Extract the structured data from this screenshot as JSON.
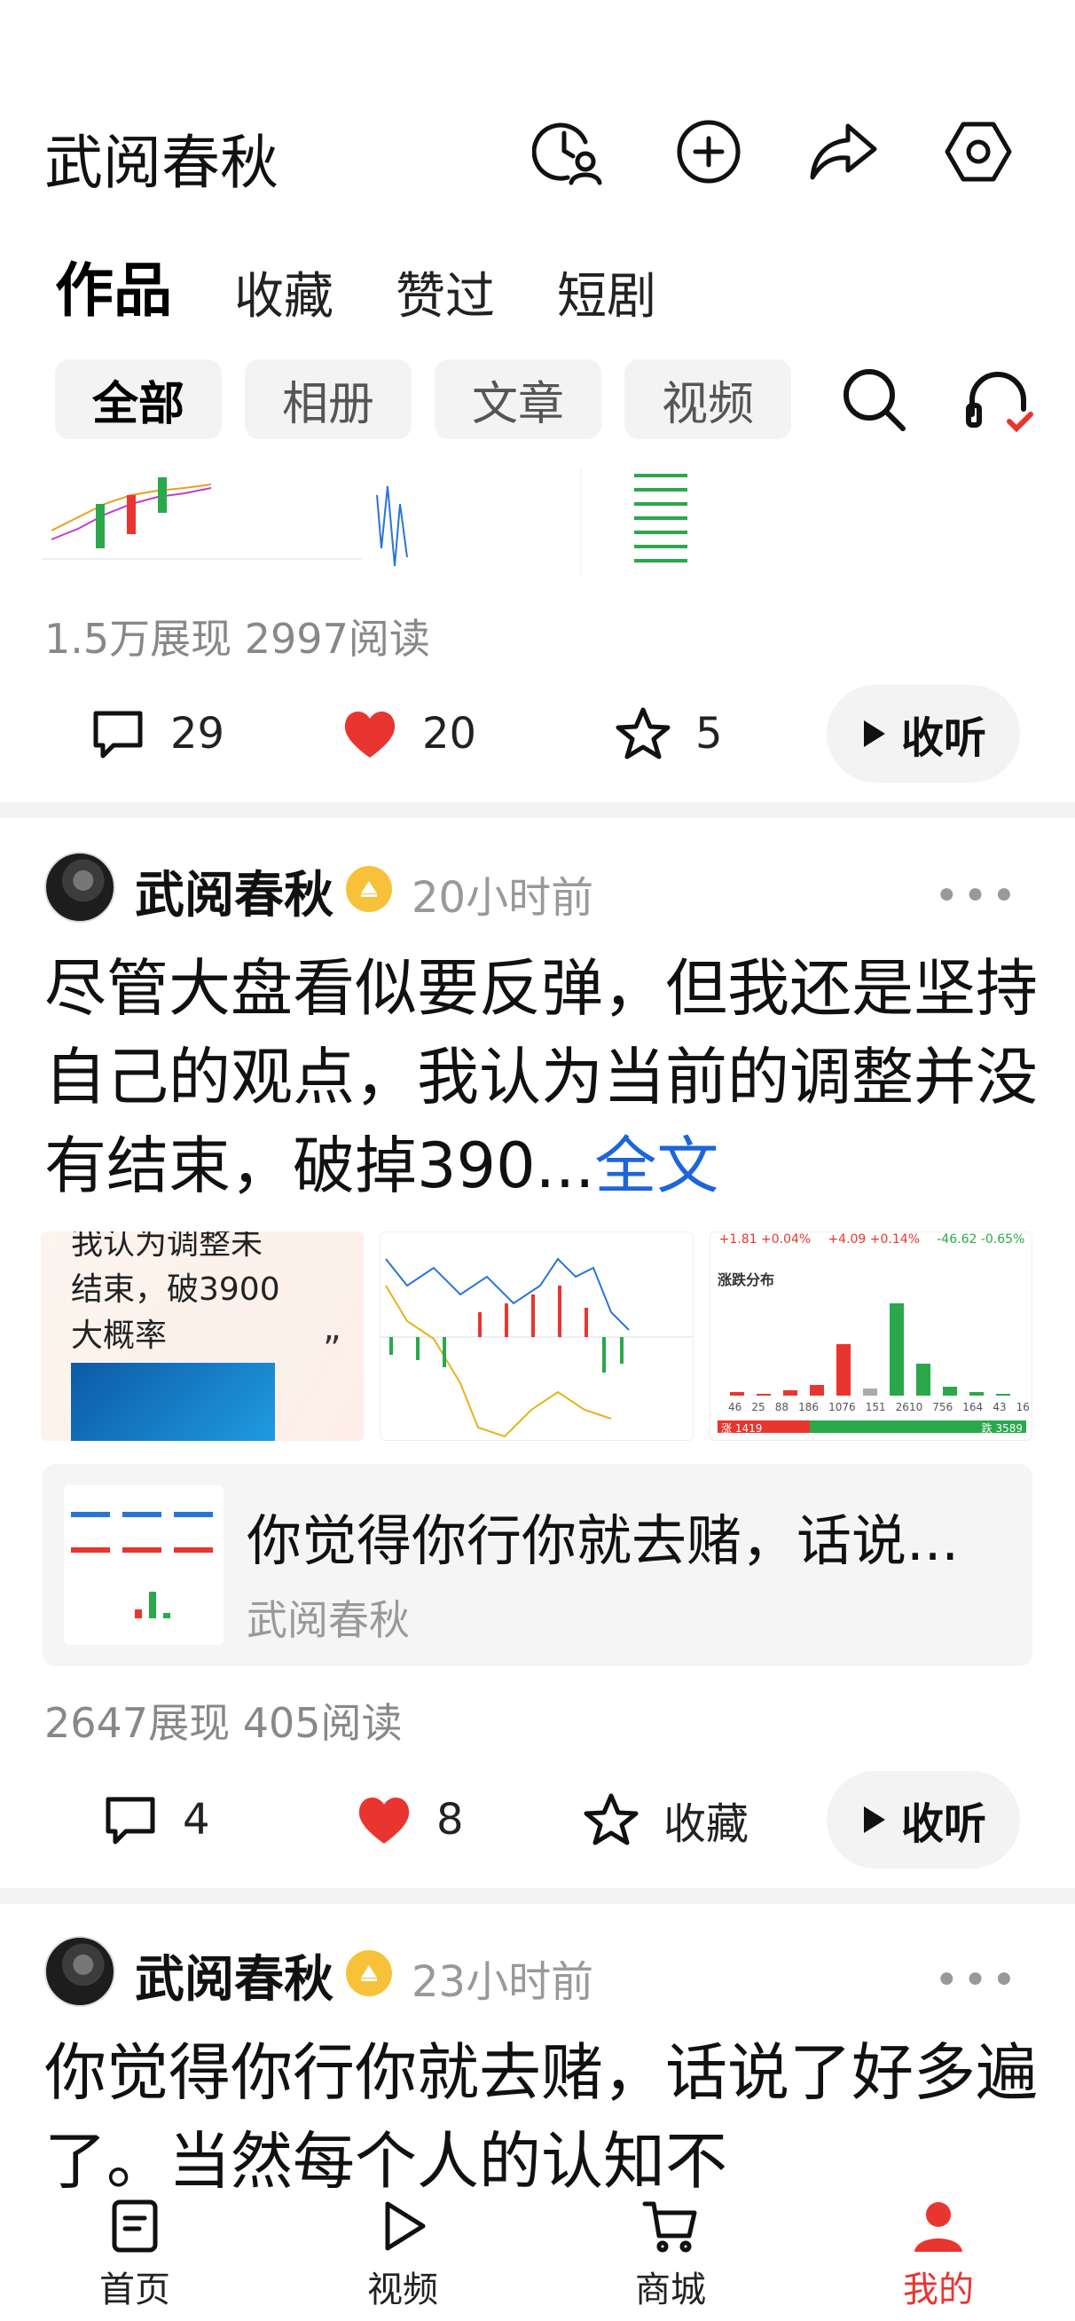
{
  "header": {
    "title": "武阅春秋",
    "icons": [
      "history-user-icon",
      "add-icon",
      "share-icon",
      "settings-icon"
    ]
  },
  "tabs": [
    {
      "label": "作品",
      "active": true
    },
    {
      "label": "收藏",
      "active": false
    },
    {
      "label": "赞过",
      "active": false
    },
    {
      "label": "短剧",
      "active": false
    }
  ],
  "chips": [
    {
      "label": "全部",
      "active": true
    },
    {
      "label": "相册",
      "active": false
    },
    {
      "label": "文章",
      "active": false
    },
    {
      "label": "视频",
      "active": false
    }
  ],
  "post1": {
    "stats": "1.5万展现  2997阅读",
    "comments": "29",
    "likes": "20",
    "favorites": "5",
    "listen": "收听"
  },
  "post2": {
    "author": "武阅春秋",
    "time": "20小时前",
    "text": "尽管大盘看似要反弹，但我还是坚持自己的观点，我认为当前的调整并没有结束，破掉390...",
    "full_link": "全文",
    "image_text": {
      "quote_lines": [
        "我认为调整未",
        "结束，破3900",
        "大概率"
      ],
      "chart_bar_labels": [
        "46",
        "25",
        "88",
        "186",
        "1076",
        "151",
        "2610",
        "756",
        "164",
        "43",
        "16"
      ],
      "chart_title": "涨跌分布",
      "chart_top": [
        "+1.81 +0.04%",
        "+4.09 +0.14%",
        "-46.62 -0.65%"
      ],
      "chart_bottom_left": "涨 1419",
      "chart_bottom_right": "跌 3589"
    },
    "share": {
      "title": "你觉得你行你就去赌，话说...",
      "author": "武阅春秋"
    },
    "stats": "2647展现  405阅读",
    "comments": "4",
    "likes": "8",
    "favorite_label": "收藏",
    "listen": "收听"
  },
  "post3": {
    "author": "武阅春秋",
    "time": "23小时前",
    "text": "你觉得你行你就去赌，话说了好多遍了。当然每个人的认知不"
  },
  "nav": [
    {
      "label": "首页",
      "icon": "home-doc-icon",
      "active": false
    },
    {
      "label": "视频",
      "icon": "play-icon",
      "active": false
    },
    {
      "label": "商城",
      "icon": "cart-icon",
      "active": false
    },
    {
      "label": "我的",
      "icon": "person-icon",
      "active": true
    }
  ],
  "colors": {
    "accent_red": "#e9352f",
    "link_blue": "#1d66d8",
    "muted": "#999999",
    "chip_bg": "#f3f3f4"
  }
}
